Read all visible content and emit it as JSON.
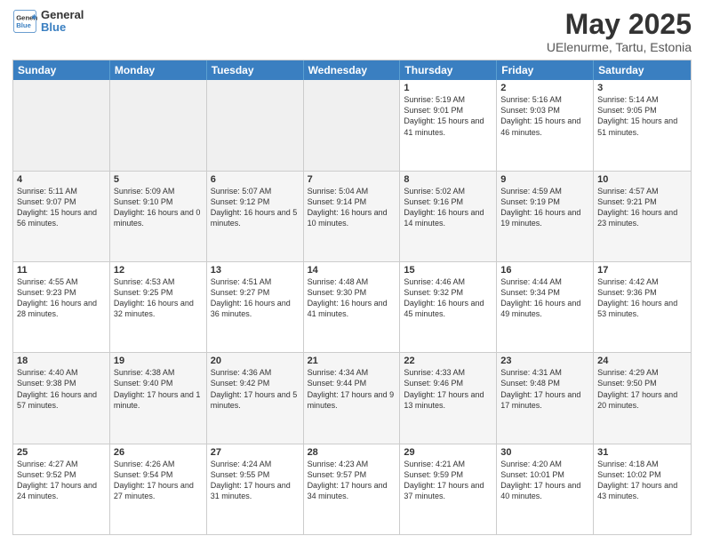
{
  "header": {
    "logo_general": "General",
    "logo_blue": "Blue",
    "main_title": "May 2025",
    "subtitle": "UElenurme, Tartu, Estonia"
  },
  "calendar": {
    "days_of_week": [
      "Sunday",
      "Monday",
      "Tuesday",
      "Wednesday",
      "Thursday",
      "Friday",
      "Saturday"
    ],
    "weeks": [
      [
        {
          "day": "",
          "info": "",
          "empty": true
        },
        {
          "day": "",
          "info": "",
          "empty": true
        },
        {
          "day": "",
          "info": "",
          "empty": true
        },
        {
          "day": "",
          "info": "",
          "empty": true
        },
        {
          "day": "1",
          "info": "Sunrise: 5:19 AM\nSunset: 9:01 PM\nDaylight: 15 hours\nand 41 minutes."
        },
        {
          "day": "2",
          "info": "Sunrise: 5:16 AM\nSunset: 9:03 PM\nDaylight: 15 hours\nand 46 minutes."
        },
        {
          "day": "3",
          "info": "Sunrise: 5:14 AM\nSunset: 9:05 PM\nDaylight: 15 hours\nand 51 minutes."
        }
      ],
      [
        {
          "day": "4",
          "info": "Sunrise: 5:11 AM\nSunset: 9:07 PM\nDaylight: 15 hours\nand 56 minutes."
        },
        {
          "day": "5",
          "info": "Sunrise: 5:09 AM\nSunset: 9:10 PM\nDaylight: 16 hours\nand 0 minutes."
        },
        {
          "day": "6",
          "info": "Sunrise: 5:07 AM\nSunset: 9:12 PM\nDaylight: 16 hours\nand 5 minutes."
        },
        {
          "day": "7",
          "info": "Sunrise: 5:04 AM\nSunset: 9:14 PM\nDaylight: 16 hours\nand 10 minutes."
        },
        {
          "day": "8",
          "info": "Sunrise: 5:02 AM\nSunset: 9:16 PM\nDaylight: 16 hours\nand 14 minutes."
        },
        {
          "day": "9",
          "info": "Sunrise: 4:59 AM\nSunset: 9:19 PM\nDaylight: 16 hours\nand 19 minutes."
        },
        {
          "day": "10",
          "info": "Sunrise: 4:57 AM\nSunset: 9:21 PM\nDaylight: 16 hours\nand 23 minutes."
        }
      ],
      [
        {
          "day": "11",
          "info": "Sunrise: 4:55 AM\nSunset: 9:23 PM\nDaylight: 16 hours\nand 28 minutes."
        },
        {
          "day": "12",
          "info": "Sunrise: 4:53 AM\nSunset: 9:25 PM\nDaylight: 16 hours\nand 32 minutes."
        },
        {
          "day": "13",
          "info": "Sunrise: 4:51 AM\nSunset: 9:27 PM\nDaylight: 16 hours\nand 36 minutes."
        },
        {
          "day": "14",
          "info": "Sunrise: 4:48 AM\nSunset: 9:30 PM\nDaylight: 16 hours\nand 41 minutes."
        },
        {
          "day": "15",
          "info": "Sunrise: 4:46 AM\nSunset: 9:32 PM\nDaylight: 16 hours\nand 45 minutes."
        },
        {
          "day": "16",
          "info": "Sunrise: 4:44 AM\nSunset: 9:34 PM\nDaylight: 16 hours\nand 49 minutes."
        },
        {
          "day": "17",
          "info": "Sunrise: 4:42 AM\nSunset: 9:36 PM\nDaylight: 16 hours\nand 53 minutes."
        }
      ],
      [
        {
          "day": "18",
          "info": "Sunrise: 4:40 AM\nSunset: 9:38 PM\nDaylight: 16 hours\nand 57 minutes."
        },
        {
          "day": "19",
          "info": "Sunrise: 4:38 AM\nSunset: 9:40 PM\nDaylight: 17 hours\nand 1 minute."
        },
        {
          "day": "20",
          "info": "Sunrise: 4:36 AM\nSunset: 9:42 PM\nDaylight: 17 hours\nand 5 minutes."
        },
        {
          "day": "21",
          "info": "Sunrise: 4:34 AM\nSunset: 9:44 PM\nDaylight: 17 hours\nand 9 minutes."
        },
        {
          "day": "22",
          "info": "Sunrise: 4:33 AM\nSunset: 9:46 PM\nDaylight: 17 hours\nand 13 minutes."
        },
        {
          "day": "23",
          "info": "Sunrise: 4:31 AM\nSunset: 9:48 PM\nDaylight: 17 hours\nand 17 minutes."
        },
        {
          "day": "24",
          "info": "Sunrise: 4:29 AM\nSunset: 9:50 PM\nDaylight: 17 hours\nand 20 minutes."
        }
      ],
      [
        {
          "day": "25",
          "info": "Sunrise: 4:27 AM\nSunset: 9:52 PM\nDaylight: 17 hours\nand 24 minutes."
        },
        {
          "day": "26",
          "info": "Sunrise: 4:26 AM\nSunset: 9:54 PM\nDaylight: 17 hours\nand 27 minutes."
        },
        {
          "day": "27",
          "info": "Sunrise: 4:24 AM\nSunset: 9:55 PM\nDaylight: 17 hours\nand 31 minutes."
        },
        {
          "day": "28",
          "info": "Sunrise: 4:23 AM\nSunset: 9:57 PM\nDaylight: 17 hours\nand 34 minutes."
        },
        {
          "day": "29",
          "info": "Sunrise: 4:21 AM\nSunset: 9:59 PM\nDaylight: 17 hours\nand 37 minutes."
        },
        {
          "day": "30",
          "info": "Sunrise: 4:20 AM\nSunset: 10:01 PM\nDaylight: 17 hours\nand 40 minutes."
        },
        {
          "day": "31",
          "info": "Sunrise: 4:18 AM\nSunset: 10:02 PM\nDaylight: 17 hours\nand 43 minutes."
        }
      ]
    ]
  }
}
